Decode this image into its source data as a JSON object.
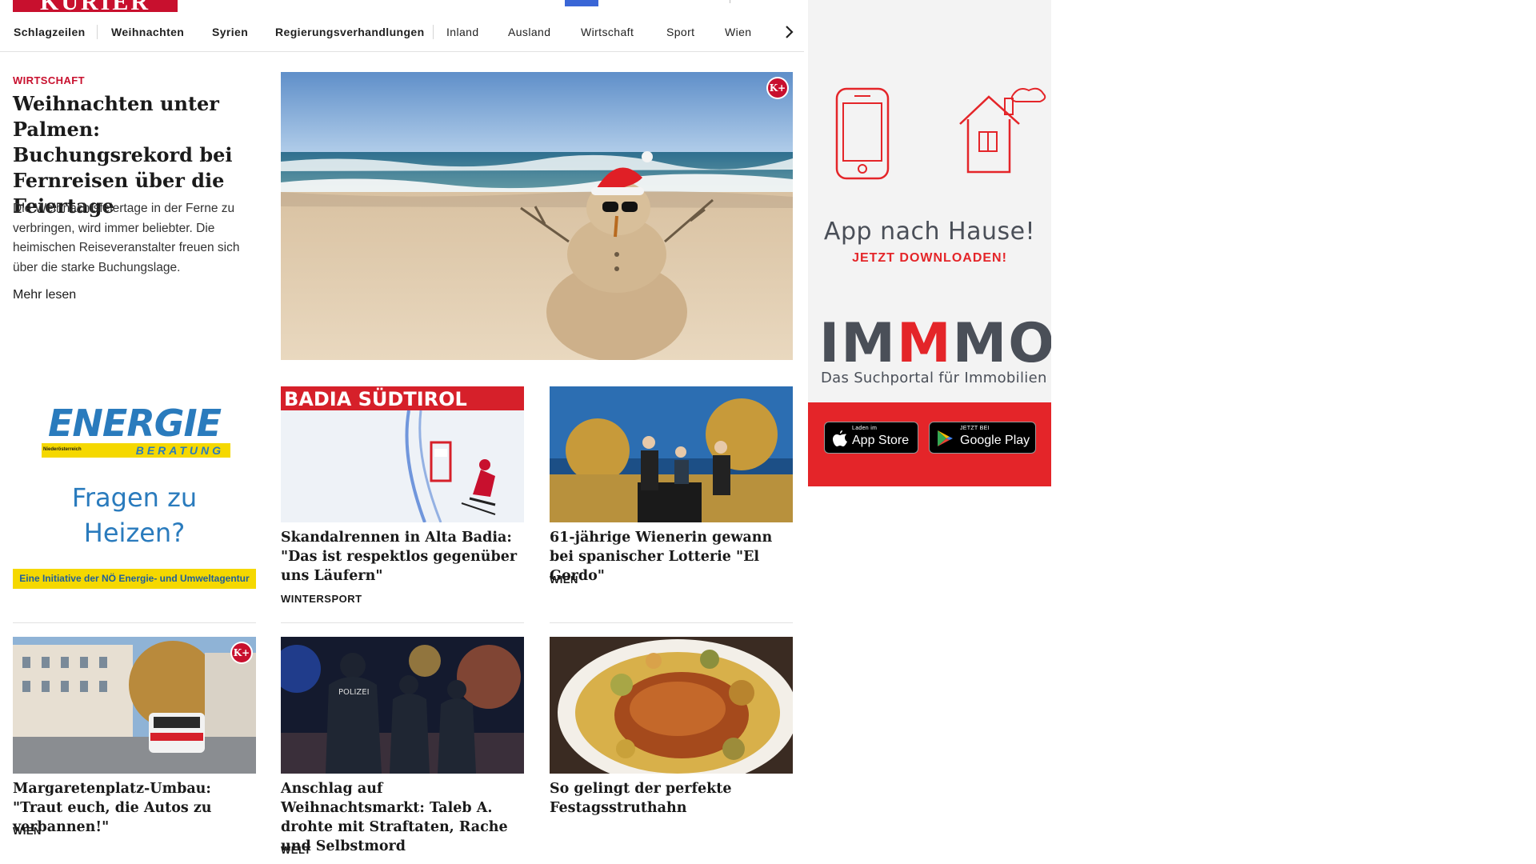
{
  "header": {
    "logo_text": "KURIER"
  },
  "nav": {
    "items": [
      "Schlagzeilen",
      "Weihnachten",
      "Syrien",
      "Regierungsverhandlungen",
      "Inland",
      "Ausland",
      "Wirtschaft",
      "Sport",
      "Wien"
    ]
  },
  "lead": {
    "kicker": "WIRTSCHAFT",
    "title": "Weihnachten unter Pal­men: Buchungsrekord bei Fernreisen über die Feiertage",
    "teaser": "Die Weihnachtsfeiertage in der Ferne zu verbringen, wird immer beliebter. Die heimischen Reiseveranstalter freuen sich über die starke Buchungslage.",
    "more": "Mehr lesen",
    "badge": "K+"
  },
  "energie_ad": {
    "logo": "ENERGIE",
    "logo_sub": "BERATUNG",
    "logo_region": "Niederösterreich",
    "question_line1": "Fragen zu",
    "question_line2": "Heizen?",
    "footer": "Eine Initiative der NÖ Energie- und Umweltagentur"
  },
  "cards": [
    {
      "title": "Skandalrennen in Alta Badia: \"Das ist respektlos gegenüber uns Läufern\"",
      "category": "WINTERSPORT",
      "banner_text": "BADIA SÜDTIROL"
    },
    {
      "title": "61-jährige Wienerin gewann bei spanischer Lotterie \"El Gordo\"",
      "category": "WIEN"
    },
    {
      "title": "Margaretenplatz-Umbau: \"Traut euch, die Autos zu verbannen!\"",
      "category": "WIEN",
      "badge": "K+"
    },
    {
      "title": "Anschlag auf Weihnachtsmarkt: Taleb A. drohte mit Straftaten, Ra­che und Selbstmord",
      "category": "WELT"
    },
    {
      "title": "So gelingt der perfekte Festagsstruthahn",
      "category": ""
    }
  ],
  "side_ad": {
    "title": "App nach Hause!",
    "subtitle": "JETZT DOWNLOADEN!",
    "brand_pre": "IM",
    "brand_mid": "M",
    "brand_post": "MO",
    "brand_sub": "Das Suchportal für Immobilien",
    "appstore_small": "Laden im",
    "appstore_big": "App Store",
    "googleplay_small": "JETZT BEI",
    "googleplay_big": "Google Play"
  },
  "colors": {
    "brand_red": "#c8102e",
    "immo_red": "#e42529",
    "energie_blue": "#2a7bbd",
    "energie_yellow": "#f5d800"
  }
}
